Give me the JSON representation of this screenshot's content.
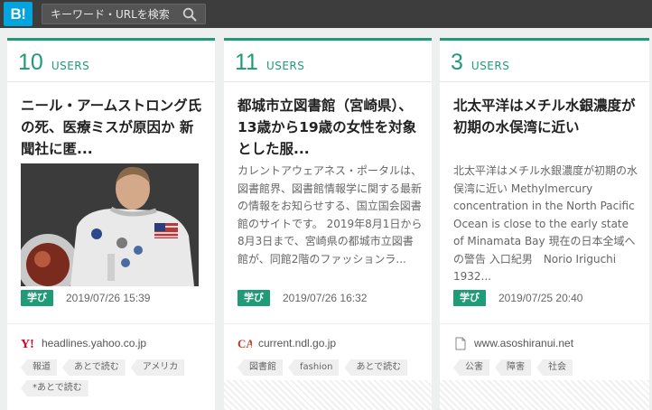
{
  "header": {
    "logo": "B!",
    "search_placeholder": "キーワード・URLを検索"
  },
  "colors": {
    "accent": "#1f9b77",
    "brand": "#00a4de",
    "topbar": "#3d3d3d"
  },
  "cards": [
    {
      "users_count": "10",
      "users_label": "USERS",
      "title": "ニール・アームストロング氏の死、医療ミスが原因か 新聞社に匿...",
      "category": "学び",
      "date": "2019/07/26 15:39",
      "site": "headlines.yahoo.co.jp",
      "favicon": "yahoo-icon",
      "tags": [
        "報道",
        "あとで読む",
        "アメリカ",
        "*あとで読む"
      ]
    },
    {
      "users_count": "11",
      "users_label": "USERS",
      "title": "都城市立図書館（宮崎県）、13歳から19歳の女性を対象とした服...",
      "excerpt": "カレントアウェアネス・ポータルは、図書館界、図書館情報学に関する最新の情報をお知らせする、国立国会図書館のサイトです。 2019年8月1日から8月3日まで、宮崎県の都城市立図書館が、同館2階のファッションラ...",
      "category": "学び",
      "date": "2019/07/26 16:32",
      "site": "current.ndl.go.jp",
      "favicon": "ca-icon",
      "tags": [
        "図書館",
        "fashion",
        "あとで読む"
      ]
    },
    {
      "users_count": "3",
      "users_label": "USERS",
      "title": "北太平洋はメチル水銀濃度が初期の水俣湾に近い",
      "excerpt": "北太平洋はメチル水銀濃度が初期の水俣湾に近い Methylmercury concentration in the North Pacific Ocean is close to the early state of Minamata Bay 現在の日本全域への警告 入口紀男　Norio Iriguchi 1932...",
      "category": "学び",
      "date": "2019/07/25 20:40",
      "site": "www.asoshiranui.net",
      "favicon": "page-icon",
      "tags": [
        "公害",
        "障害",
        "社会"
      ]
    }
  ]
}
